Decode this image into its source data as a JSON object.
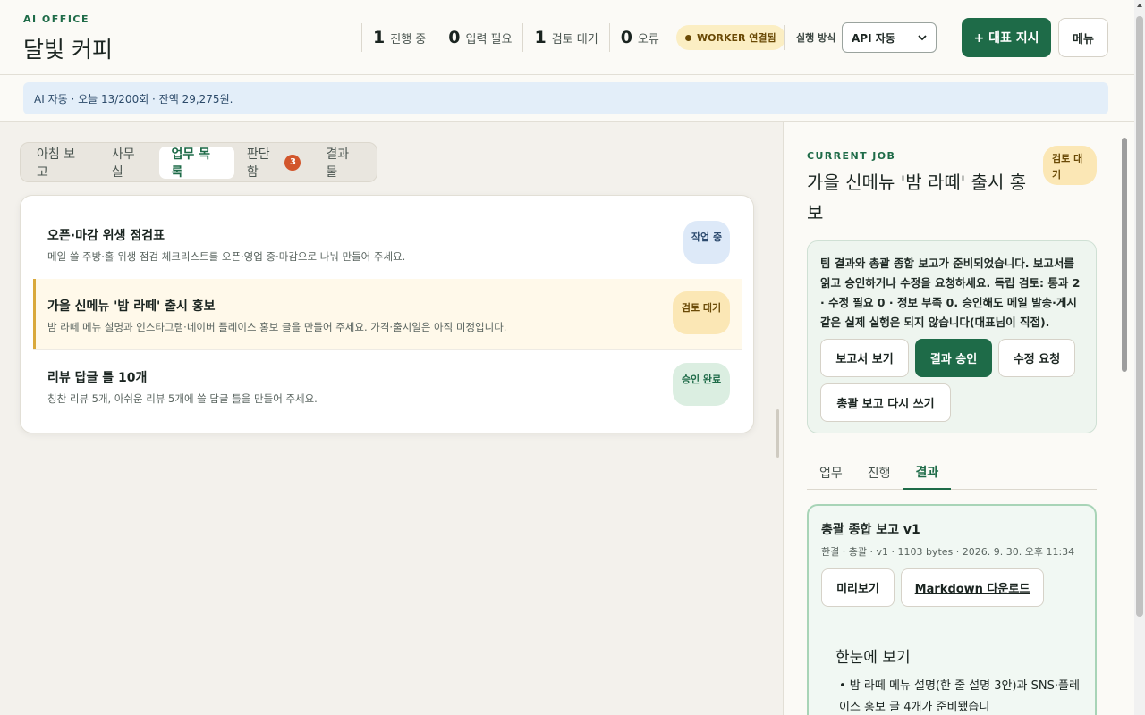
{
  "header": {
    "brand_small": "AI OFFICE",
    "brand_title": "달빛 커피",
    "stats": [
      {
        "num": "1",
        "label": "진행 중"
      },
      {
        "num": "0",
        "label": "입력 필요"
      },
      {
        "num": "1",
        "label": "검토 대기"
      },
      {
        "num": "0",
        "label": "오류"
      }
    ],
    "worker_badge": "WORKER 연결됨",
    "run_label": "실행 방식",
    "run_select": "API 자동",
    "primary_button": "+ 대표 지시",
    "menu_button": "메뉴"
  },
  "info_bar": "AI 자동 · 오늘 13/200회 · 잔액 29,275원.",
  "left": {
    "tabs": [
      {
        "label": "아침 보고"
      },
      {
        "label": "사무실"
      },
      {
        "label": "업무 목록",
        "active": true
      },
      {
        "label": "판단함",
        "count": "3"
      },
      {
        "label": "결과물"
      }
    ],
    "rows": [
      {
        "title": "오픈·마감 위생 점검표",
        "desc": "메일 쓸 주방·홀 위생 점검 체크리스트를 오픈·영업 중·마감으로 나눠 만들어 주세요.",
        "status": "작업 중"
      },
      {
        "title": "가을 신메뉴 '밤 라떼' 출시 홍보",
        "desc": "밤 라떼 메뉴 설명과 인스타그램·네이버 플레이스 홍보 글을 만들어 주세요. 가격·출시일은 아직 미정입니다.",
        "status": "검토 대기"
      },
      {
        "title": "리뷰 답글 틀 10개",
        "desc": "칭찬 리뷰 5개, 아쉬운 리뷰 5개에 쓸 답글 틀을 만들어 주세요.",
        "status": "승인 완료"
      }
    ]
  },
  "right": {
    "label": "CURRENT JOB",
    "title": "가을 신메뉴 '밤 라떼' 출시 홍보",
    "badge": "검토 대기",
    "review_text": "팀 결과와 총괄 종합 보고가 준비되었습니다. 보고서를 읽고 승인하거나 수정을 요청하세요. 독립 검토: 통과 2 · 수정 필요 0 · 정보 부족 0. 승인해도 메일 발송·게시 같은 실제 실행은 되지 않습니다(대표님이 직접).",
    "buttons": {
      "view_report": "보고서 보기",
      "approve": "결과 승인",
      "request_edit": "수정 요청",
      "rewrite": "총괄 보고 다시 쓰기"
    },
    "subtabs": [
      {
        "label": "업무"
      },
      {
        "label": "진행"
      },
      {
        "label": "결과",
        "active": true
      }
    ],
    "result": {
      "title": "총괄 종합 보고 v1",
      "meta": "한결 · 총괄 · v1 · 1103 bytes · 2026. 9. 30. 오후 11:34",
      "preview_button": "미리보기",
      "download_button": "Markdown 다운로드",
      "preview_heading": "한눈에 보기",
      "preview_text": "• 밤 라떼 메뉴 설명(한 줄 설명 3안)과 SNS·플레이스 홍보 글 4개가 준비됐습니"
    }
  },
  "colors": {
    "accent": "#1e6b48",
    "warning_bg": "#fbe7b5",
    "info_bg": "#e3eef9",
    "badge_red": "#d2562c"
  }
}
